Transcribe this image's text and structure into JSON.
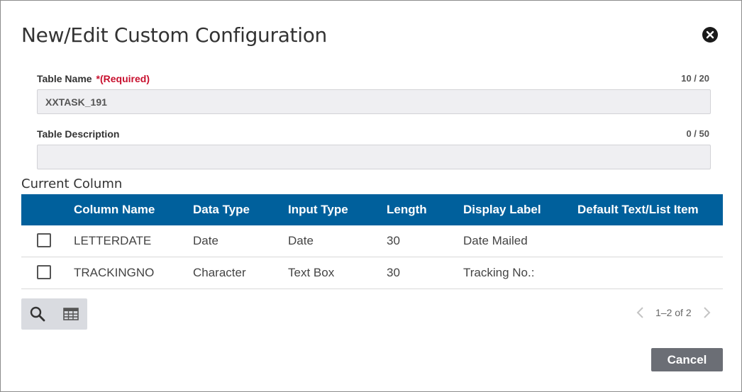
{
  "dialog": {
    "title": "New/Edit Custom Configuration"
  },
  "form": {
    "table_name": {
      "label": "Table Name",
      "required_text": "*(Required)",
      "value": "XXTASK_191",
      "counter": "10 / 20"
    },
    "table_description": {
      "label": "Table Description",
      "value": "",
      "counter": "0 / 50"
    }
  },
  "columns_section": {
    "title": "Current Column",
    "headers": [
      "Column Name",
      "Data Type",
      "Input Type",
      "Length",
      "Display Label",
      "Default Text/List Item"
    ],
    "rows": [
      {
        "column_name": "LETTERDATE",
        "data_type": "Date",
        "input_type": "Date",
        "length": "30",
        "display_label": "Date Mailed",
        "default_text": ""
      },
      {
        "column_name": "TRACKINGNO",
        "data_type": "Character",
        "input_type": "Text Box",
        "length": "30",
        "display_label": "Tracking No.:",
        "default_text": ""
      }
    ]
  },
  "toolbar": {
    "icons": [
      "search-icon",
      "table-icon"
    ]
  },
  "pagination": {
    "text": "1–2 of 2"
  },
  "footer": {
    "cancel_label": "Cancel"
  },
  "colors": {
    "header_bg": "#00609c",
    "required": "#c8102e",
    "cancel_bg": "#6b6e75"
  }
}
